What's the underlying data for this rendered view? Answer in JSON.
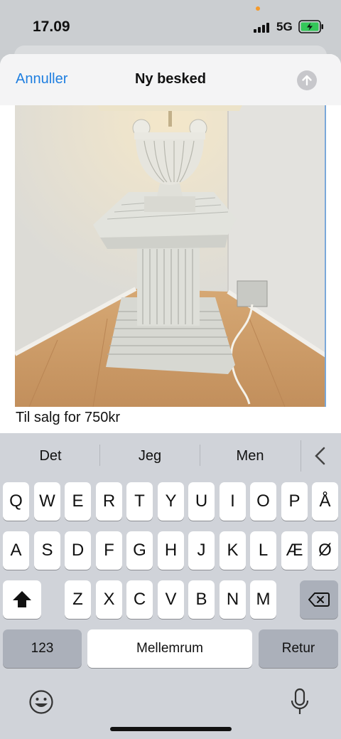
{
  "status": {
    "time": "17.09",
    "network": "5G"
  },
  "header": {
    "cancel_label": "Annuller",
    "title": "Ny besked"
  },
  "message": {
    "text": "Til salg for 750kr"
  },
  "keyboard": {
    "suggestions": [
      "Det",
      "Jeg",
      "Men"
    ],
    "row1": [
      "Q",
      "W",
      "E",
      "R",
      "T",
      "Y",
      "U",
      "I",
      "O",
      "P",
      "Å"
    ],
    "row2": [
      "A",
      "S",
      "D",
      "F",
      "G",
      "H",
      "J",
      "K",
      "L",
      "Æ",
      "Ø"
    ],
    "row3": [
      "Z",
      "X",
      "C",
      "V",
      "B",
      "N",
      "M"
    ],
    "numbers_label": "123",
    "space_label": "Mellemrum",
    "return_label": "Retur"
  },
  "colors": {
    "accent": "#1f7fe0",
    "battery": "#34c759"
  }
}
